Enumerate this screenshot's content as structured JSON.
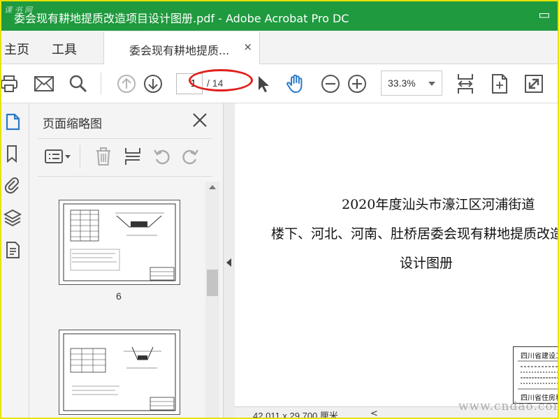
{
  "window": {
    "title": "委会现有耕地提质改造项目设计图册.pdf - Adobe Acrobat Pro DC",
    "watermark_top": "课 书 网",
    "watermark_bottom": "www.cndao.com"
  },
  "nav": {
    "home": "主页",
    "tools": "工具"
  },
  "tab": {
    "label": "委会现有耕地提质...",
    "close": "×"
  },
  "toolbar": {
    "current_page": "1",
    "total_pages": "/ 14",
    "zoom": "33.3%"
  },
  "panel": {
    "title": "页面缩略图",
    "thumbnails": [
      {
        "label": "6"
      },
      {
        "label": ""
      }
    ]
  },
  "document": {
    "lines": [
      "2020年度汕头市濠江区河浦街道",
      "楼下、河北、河南、肚桥居委会现有耕地提质改造",
      "设计图册"
    ],
    "stamp_top": "四川省建设工",
    "stamp_bottom": "四川省住房和"
  },
  "status": {
    "dimensions": "42.011 x 29.700 厘米",
    "scroll_left": "<"
  },
  "colors": {
    "titlebar": "#1f9a3f",
    "accent_blue": "#2a79c9",
    "highlight": "#e0201b"
  }
}
